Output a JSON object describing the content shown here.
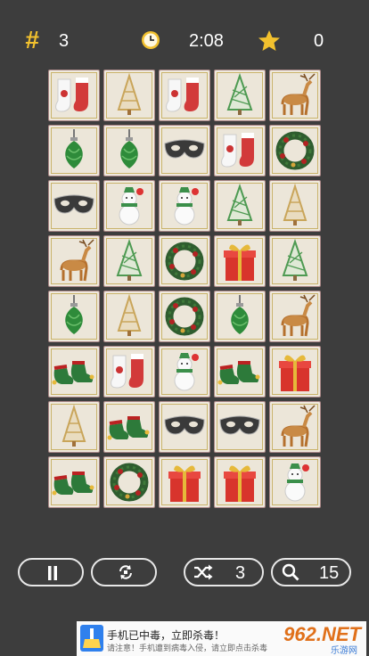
{
  "header": {
    "moves_icon": "hash-icon",
    "moves_value": "3",
    "timer_icon": "clock-icon",
    "timer_value": "2:08",
    "star_icon": "star-icon",
    "score_value": "0"
  },
  "board": {
    "rows": [
      [
        "snowman-stocking",
        "tree-gold",
        "snowman-stocking",
        "tree-green",
        "reindeer"
      ],
      [
        "ornament",
        "ornament",
        "mask",
        "snowman-stocking",
        "wreath"
      ],
      [
        "mask",
        "snowman",
        "snowman",
        "tree-green",
        "tree-gold"
      ],
      [
        "reindeer",
        "tree-green",
        "wreath",
        "gift",
        "tree-green"
      ],
      [
        "ornament",
        "tree-gold",
        "wreath",
        "ornament",
        "reindeer"
      ],
      [
        "elf-shoes",
        "snowman-stocking",
        "snowman",
        "elf-shoes",
        "gift"
      ],
      [
        "tree-gold",
        "elf-shoes",
        "mask",
        "mask",
        "reindeer"
      ],
      [
        "elf-shoes",
        "wreath",
        "gift",
        "gift",
        "snowman"
      ]
    ]
  },
  "controls": {
    "pause_icon": "pause-icon",
    "hint_icon": "rotate-icon",
    "shuffle_icon": "shuffle-icon",
    "shuffle_count": "3",
    "search_icon": "search-icon",
    "search_count": "15"
  },
  "ad": {
    "title": "手机已中毒，立即杀毒！",
    "subtitle": "请注意！手机遭到病毒入侵，请立即点击杀毒",
    "brand": "962.NET",
    "brand_sub": "乐游网"
  },
  "colors": {
    "background": "#3d3d3d",
    "accent_yellow": "#f2c12e",
    "tile_bg": "#ece6d9"
  }
}
